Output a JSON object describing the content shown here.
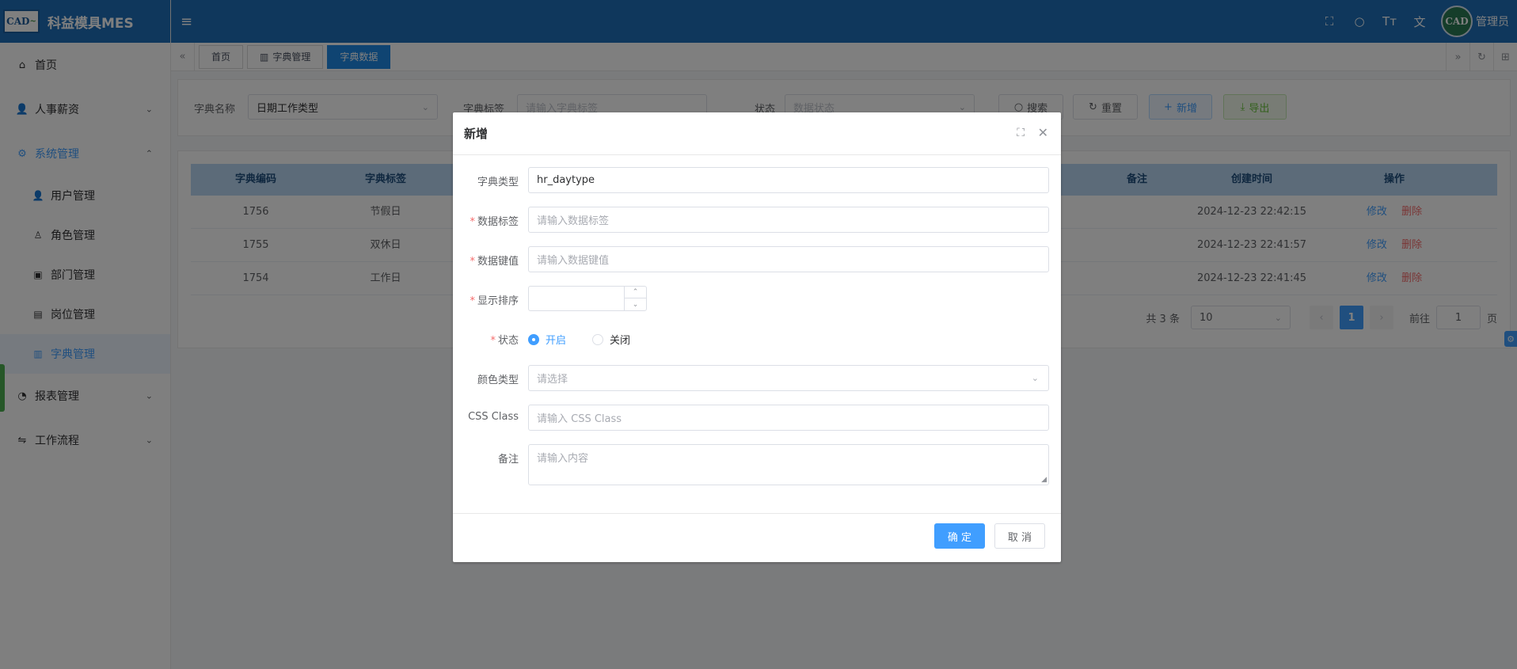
{
  "app": {
    "title": "科益模具MES",
    "logo_text": "CAD",
    "logo_sub": "~"
  },
  "sidebar": {
    "items": [
      {
        "label": "首页",
        "icon": "home-icon"
      },
      {
        "label": "人事薪资",
        "icon": "user-icon"
      },
      {
        "label": "系统管理",
        "icon": "gear-icon"
      },
      {
        "label": "报表管理",
        "icon": "pie-chart-icon"
      },
      {
        "label": "工作流程",
        "icon": "workflow-icon"
      }
    ],
    "system_sub": [
      {
        "label": "用户管理",
        "icon": "user-icon"
      },
      {
        "label": "角色管理",
        "icon": "role-icon"
      },
      {
        "label": "部门管理",
        "icon": "id-card-icon"
      },
      {
        "label": "岗位管理",
        "icon": "badge-icon"
      },
      {
        "label": "字典管理",
        "icon": "book-icon"
      }
    ]
  },
  "header": {
    "username": "管理员",
    "avatar_text": "CAD"
  },
  "tabs": [
    {
      "label": "首页"
    },
    {
      "label": "字典管理"
    },
    {
      "label": "字典数据"
    }
  ],
  "search": {
    "dict_name_label": "字典名称",
    "dict_name_value": "日期工作类型",
    "dict_label_label": "字典标签",
    "dict_label_placeholder": "请输入字典标签",
    "status_label": "状态",
    "status_placeholder": "数据状态",
    "search_btn": "搜索",
    "reset_btn": "重置",
    "add_btn": "新增",
    "export_btn": "导出"
  },
  "table": {
    "headers": {
      "code": "字典编码",
      "label": "字典标签",
      "remark": "备注",
      "created": "创建时间",
      "ops": "操作"
    },
    "rows": [
      {
        "code": "1756",
        "label": "节假日",
        "created": "2024-12-23 22:42:15"
      },
      {
        "code": "1755",
        "label": "双休日",
        "created": "2024-12-23 22:41:57"
      },
      {
        "code": "1754",
        "label": "工作日",
        "created": "2024-12-23 22:41:45"
      }
    ],
    "edit": "修改",
    "delete": "删除"
  },
  "pager": {
    "total": "共 3 条",
    "page_size": "10",
    "current": "1",
    "goto_label": "前往",
    "goto_value": "1",
    "page_unit": "页"
  },
  "dialog": {
    "title": "新增",
    "dict_type_label": "字典类型",
    "dict_type_value": "hr_daytype",
    "data_label_label": "数据标签",
    "data_label_placeholder": "请输入数据标签",
    "data_value_label": "数据键值",
    "data_value_placeholder": "请输入数据键值",
    "sort_label": "显示排序",
    "status_label": "状态",
    "status_on": "开启",
    "status_off": "关闭",
    "color_label": "颜色类型",
    "color_placeholder": "请选择",
    "css_label": "CSS Class",
    "css_placeholder": "请输入 CSS Class",
    "remark_label": "备注",
    "remark_placeholder": "请输入内容",
    "confirm": "确 定",
    "cancel": "取 消"
  }
}
